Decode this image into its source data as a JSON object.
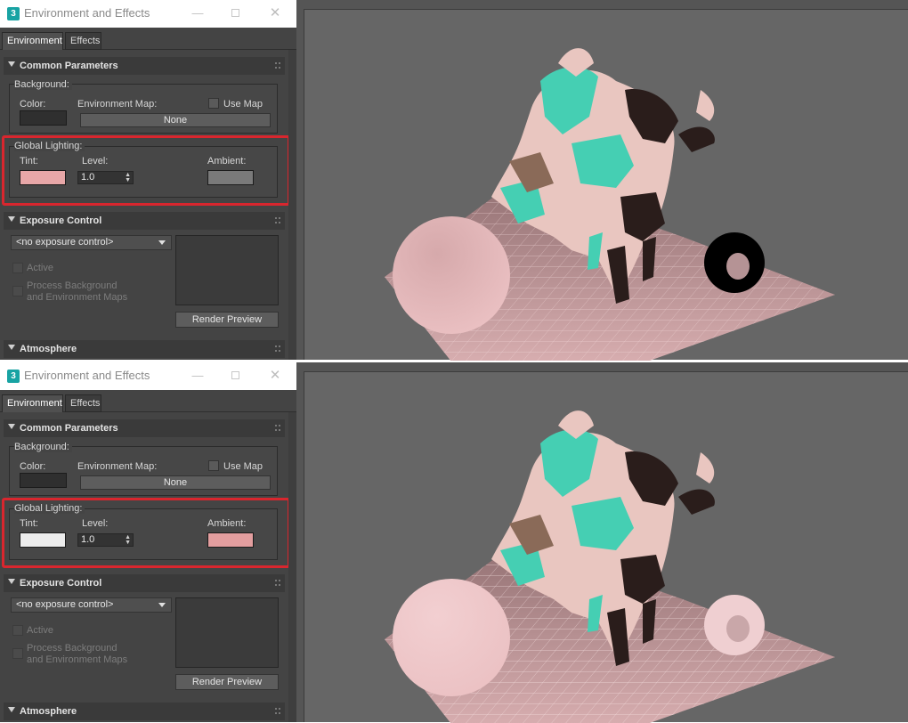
{
  "panels": [
    {
      "window_title": "Environment and Effects",
      "tabs": [
        {
          "label": "Environment",
          "active": true
        },
        {
          "label": "Effects",
          "active": false
        }
      ],
      "common_parameters": {
        "header": "Common Parameters",
        "background": {
          "group_label": "Background:",
          "color_label": "Color:",
          "color_value": "#2f2f2f",
          "env_map_label": "Environment Map:",
          "use_map_label": "Use Map",
          "use_map_checked": false,
          "env_map_button": "None"
        },
        "global_lighting": {
          "group_label": "Global Lighting:",
          "tint_label": "Tint:",
          "tint_color": "#e8a7a8",
          "level_label": "Level:",
          "level_value": "1.0",
          "ambient_label": "Ambient:",
          "ambient_color": "#7a7a7a"
        }
      },
      "exposure_control": {
        "header": "Exposure Control",
        "dropdown_value": "<no exposure control>",
        "active_label": "Active",
        "process_label_line1": "Process Background",
        "process_label_line2": "and Environment Maps",
        "render_preview_button": "Render Preview"
      },
      "atmosphere": {
        "header": "Atmosphere"
      }
    },
    {
      "window_title": "Environment and Effects",
      "tabs": [
        {
          "label": "Environment",
          "active": true
        },
        {
          "label": "Effects",
          "active": false
        }
      ],
      "common_parameters": {
        "header": "Common Parameters",
        "background": {
          "group_label": "Background:",
          "color_label": "Color:",
          "color_value": "#2f2f2f",
          "env_map_label": "Environment Map:",
          "use_map_label": "Use Map",
          "use_map_checked": false,
          "env_map_button": "None"
        },
        "global_lighting": {
          "group_label": "Global Lighting:",
          "tint_label": "Tint:",
          "tint_color": "#ececec",
          "level_label": "Level:",
          "level_value": "1.0",
          "ambient_label": "Ambient:",
          "ambient_color": "#e39e9f"
        }
      },
      "exposure_control": {
        "header": "Exposure Control",
        "dropdown_value": "<no exposure control>",
        "active_label": "Active",
        "process_label_line1": "Process Background",
        "process_label_line2": "and Environment Maps",
        "render_preview_button": "Render Preview"
      },
      "atmosphere": {
        "header": "Atmosphere"
      }
    }
  ],
  "colors": {
    "highlight_red": "#d9262e",
    "ui_bg": "#444444",
    "viewport_bg": "#666666"
  },
  "scene": {
    "colors": {
      "sphere_top": "#d6a9ab",
      "sphere_bottom": "#ebc1c3",
      "floor_top": "#927072",
      "floor_bottom": "#d7adaf",
      "teal": "#45cfb3",
      "pink": "#e9c6c0",
      "dark": "#2a1d1b",
      "brown": "#8a6a58"
    }
  }
}
